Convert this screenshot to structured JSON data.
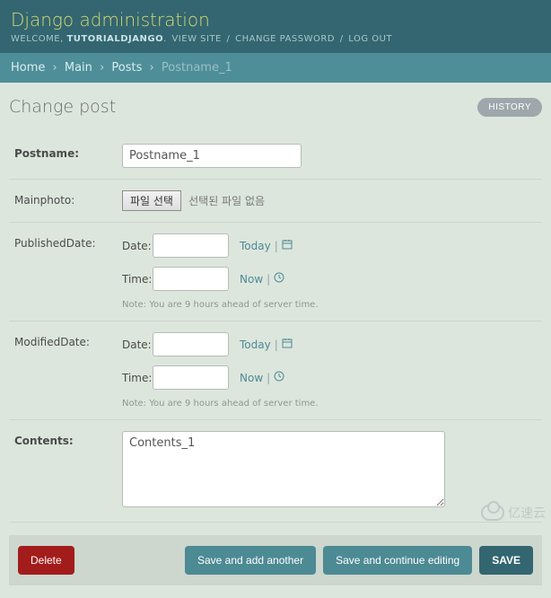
{
  "header": {
    "branding": "Django administration",
    "welcome": "WELCOME,",
    "user": "TUTORIALDJANGO",
    "links": {
      "view_site": "VIEW SITE",
      "change_pw": "CHANGE PASSWORD",
      "logout": "LOG OUT"
    }
  },
  "breadcrumbs": {
    "home": "Home",
    "app": "Main",
    "model": "Posts",
    "current": "Postname_1"
  },
  "page": {
    "title": "Change post",
    "history": "HISTORY"
  },
  "fields": {
    "postname": {
      "label": "Postname:",
      "value": "Postname_1"
    },
    "mainphoto": {
      "label": "Mainphoto:",
      "btn": "파일 선택",
      "status": "선택된 파일 없음"
    },
    "published": {
      "label": "PublishedDate:"
    },
    "modified": {
      "label": "ModifiedDate:"
    },
    "contents": {
      "label": "Contents:",
      "value": "Contents_1"
    }
  },
  "dt": {
    "date_label": "Date:",
    "time_label": "Time:",
    "today": "Today",
    "now": "Now",
    "tz_note": "Note: You are 9 hours ahead of server time."
  },
  "submit": {
    "delete": "Delete",
    "save_add": "Save and add another",
    "save_cont": "Save and continue editing",
    "save": "SAVE"
  },
  "watermark": "亿速云"
}
